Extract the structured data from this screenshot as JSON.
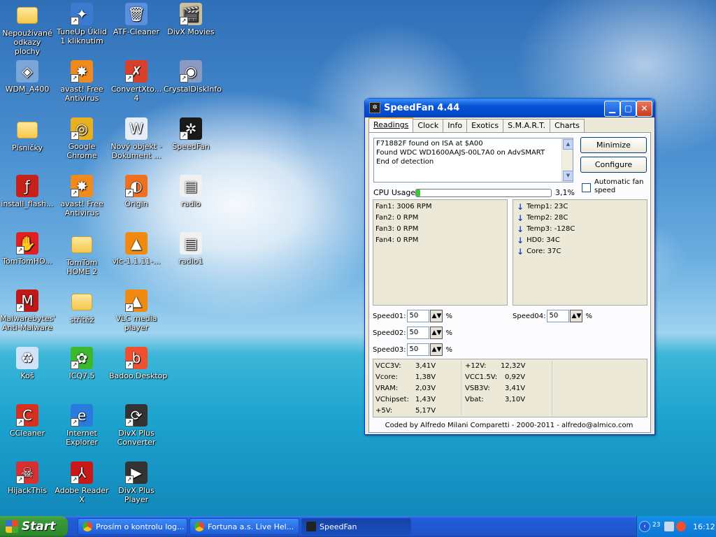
{
  "desktop_icons": [
    {
      "name": "folder-icon",
      "label": "Nepoužívané odkazy plochy",
      "col": 0,
      "row": 0,
      "color": "#f3c84a",
      "glyph": "",
      "shortcut": false
    },
    {
      "name": "tuneup-icon",
      "label": "TuneUp Úklid 1 kliknutím",
      "col": 1,
      "row": 0,
      "color": "#3a7ad0",
      "glyph": "✦",
      "shortcut": true
    },
    {
      "name": "atf-cleaner-icon",
      "label": "ATF-Cleaner",
      "col": 2,
      "row": 0,
      "color": "#5a8fe0",
      "glyph": "🗑",
      "shortcut": false
    },
    {
      "name": "divx-movies-icon",
      "label": "DivX Movies",
      "col": 3,
      "row": 0,
      "color": "#c9c0a0",
      "glyph": "🎬",
      "shortcut": true
    },
    {
      "name": "wdm-icon",
      "label": "WDM_A400",
      "col": 0,
      "row": 1,
      "color": "#7aa6d8",
      "glyph": "◈",
      "shortcut": false
    },
    {
      "name": "avast-icon",
      "label": "avast! Free Antivirus",
      "col": 1,
      "row": 1,
      "color": "#f08a1c",
      "glyph": "✸",
      "shortcut": true
    },
    {
      "name": "convertxto-icon",
      "label": "ConvertXto... 4",
      "col": 2,
      "row": 1,
      "color": "#d8402a",
      "glyph": "✗",
      "shortcut": true
    },
    {
      "name": "crystaldiskinfo-icon",
      "label": "CrystalDiskInfo",
      "col": 3,
      "row": 1,
      "color": "#8a9ac0",
      "glyph": "◉",
      "shortcut": true
    },
    {
      "name": "folder-icon",
      "label": "Písničky",
      "col": 0,
      "row": 2,
      "color": "#f3c84a",
      "glyph": "",
      "shortcut": false
    },
    {
      "name": "chrome-icon",
      "label": "Google Chrome",
      "col": 1,
      "row": 2,
      "color": "#e8b020",
      "glyph": "◎",
      "shortcut": true
    },
    {
      "name": "word-document-icon",
      "label": "Nový objekt - Dokument ...",
      "col": 2,
      "row": 2,
      "color": "#e8eef8",
      "glyph": "W",
      "shortcut": false
    },
    {
      "name": "speedfan-icon",
      "label": "SpeedFan",
      "col": 3,
      "row": 2,
      "color": "#1a1a1a",
      "glyph": "✲",
      "shortcut": true
    },
    {
      "name": "flash-installer-icon",
      "label": "install_flash...",
      "col": 0,
      "row": 3,
      "color": "#c8201a",
      "glyph": "ƒ",
      "shortcut": false
    },
    {
      "name": "avast-icon",
      "label": "avast! Free Antivirus",
      "col": 1,
      "row": 3,
      "color": "#f08a1c",
      "glyph": "✸",
      "shortcut": true
    },
    {
      "name": "origin-icon",
      "label": "Origin",
      "col": 2,
      "row": 3,
      "color": "#f07020",
      "glyph": "◐",
      "shortcut": true
    },
    {
      "name": "radio-icon",
      "label": "radio",
      "col": 3,
      "row": 3,
      "color": "#f0f0f0",
      "glyph": "▤",
      "shortcut": false
    },
    {
      "name": "tomtom-icon",
      "label": "TomTomHO...",
      "col": 0,
      "row": 4,
      "color": "#e02020",
      "glyph": "✋",
      "shortcut": true
    },
    {
      "name": "folder-icon",
      "label": "TomTom HOME 2",
      "col": 1,
      "row": 4,
      "color": "#f3c84a",
      "glyph": "",
      "shortcut": false
    },
    {
      "name": "vlc-icon",
      "label": "vlc-1.1.11-...",
      "col": 2,
      "row": 4,
      "color": "#f08a10",
      "glyph": "▲",
      "shortcut": false
    },
    {
      "name": "radio-icon",
      "label": "radio1",
      "col": 3,
      "row": 4,
      "color": "#f0f0f0",
      "glyph": "▤",
      "shortcut": false
    },
    {
      "name": "malwarebytes-icon",
      "label": "Malwarebytes' Anti-Malware",
      "col": 0,
      "row": 5,
      "color": "#c01818",
      "glyph": "M",
      "shortcut": true
    },
    {
      "name": "folder-icon",
      "label": "střítěž",
      "col": 1,
      "row": 5,
      "color": "#f3c84a",
      "glyph": "",
      "shortcut": false
    },
    {
      "name": "vlc-icon",
      "label": "VLC media player",
      "col": 2,
      "row": 5,
      "color": "#f08a10",
      "glyph": "▲",
      "shortcut": true
    },
    {
      "name": "recycle-bin-icon",
      "label": "Koš",
      "col": 0,
      "row": 6,
      "color": "#cfe4f8",
      "glyph": "♻",
      "shortcut": false
    },
    {
      "name": "icq-icon",
      "label": "ICQ7.5",
      "col": 1,
      "row": 6,
      "color": "#3cb82c",
      "glyph": "✿",
      "shortcut": true
    },
    {
      "name": "badoo-icon",
      "label": "Badoo.Desktop",
      "col": 2,
      "row": 6,
      "color": "#f05030",
      "glyph": "b",
      "shortcut": true
    },
    {
      "name": "ccleaner-icon",
      "label": "CCleaner",
      "col": 0,
      "row": 7,
      "color": "#d83020",
      "glyph": "C",
      "shortcut": true
    },
    {
      "name": "internet-explorer-icon",
      "label": "Internet Explorer",
      "col": 1,
      "row": 7,
      "color": "#2a7ae0",
      "glyph": "e",
      "shortcut": true
    },
    {
      "name": "divx-converter-icon",
      "label": "DivX Plus Converter",
      "col": 2,
      "row": 7,
      "color": "#333333",
      "glyph": "⟳",
      "shortcut": true
    },
    {
      "name": "hijackthis-icon",
      "label": "HijackThis",
      "col": 0,
      "row": 8,
      "color": "#d83030",
      "glyph": "☠",
      "shortcut": true
    },
    {
      "name": "adobe-reader-icon",
      "label": "Adobe Reader X",
      "col": 1,
      "row": 8,
      "color": "#c81818",
      "glyph": "⅄",
      "shortcut": true
    },
    {
      "name": "divx-player-icon",
      "label": "DivX Plus Player",
      "col": 2,
      "row": 8,
      "color": "#333333",
      "glyph": "▶",
      "shortcut": true
    }
  ],
  "window": {
    "title": "SpeedFan 4.44",
    "tabs": [
      "Readings",
      "Clock",
      "Info",
      "Exotics",
      "S.M.A.R.T.",
      "Charts"
    ],
    "log_lines": [
      "F71882F found on ISA at $A00",
      "Found WDC WD1600AAJS-00L7A0 on AdvSMART",
      "End of detection"
    ],
    "minimize_label": "Minimize",
    "configure_label": "Configure",
    "cpu_label": "CPU Usage",
    "cpu_value": "3,1%",
    "cpu_fraction": 0.031,
    "auto_fan_label": "Automatic fan speed",
    "fans": [
      "Fan1: 3006 RPM",
      "Fan2: 0 RPM",
      "Fan3: 0 RPM",
      "Fan4: 0 RPM"
    ],
    "temps": [
      "Temp1: 23C",
      "Temp2: 28C",
      "Temp3: -128C",
      "HD0:    34C",
      "Core:   37C"
    ],
    "speeds": [
      {
        "label": "Speed01:",
        "value": "50",
        "pct": "%"
      },
      {
        "label": "Speed02:",
        "value": "50",
        "pct": "%"
      },
      {
        "label": "Speed03:",
        "value": "50",
        "pct": "%"
      },
      {
        "label": "Speed04:",
        "value": "50",
        "pct": "%"
      }
    ],
    "voltages_left": [
      {
        "label": "VCC3V:",
        "value": "3,41V"
      },
      {
        "label": "Vcore:",
        "value": "1,38V"
      },
      {
        "label": "VRAM:",
        "value": "2,03V"
      },
      {
        "label": "VChipset:",
        "value": "1,43V"
      },
      {
        "label": "+5V:",
        "value": "5,17V"
      }
    ],
    "voltages_right": [
      {
        "label": "+12V:",
        "value": "12,32V"
      },
      {
        "label": "VCC1.5V:",
        "value": "0,92V"
      },
      {
        "label": "VSB3V:",
        "value": "3,41V"
      },
      {
        "label": "Vbat:",
        "value": "3,10V"
      }
    ],
    "footer": "Coded by Alfredo Milani Comparetti - 2000-2011 - alfredo@almico.com"
  },
  "taskbar": {
    "start_label": "Start",
    "tasks": [
      "Prosím o kontrolu log...",
      "Fortuna a.s. Live Hel...",
      "SpeedFan"
    ],
    "clock": "16:12",
    "tray_badge": "23"
  }
}
